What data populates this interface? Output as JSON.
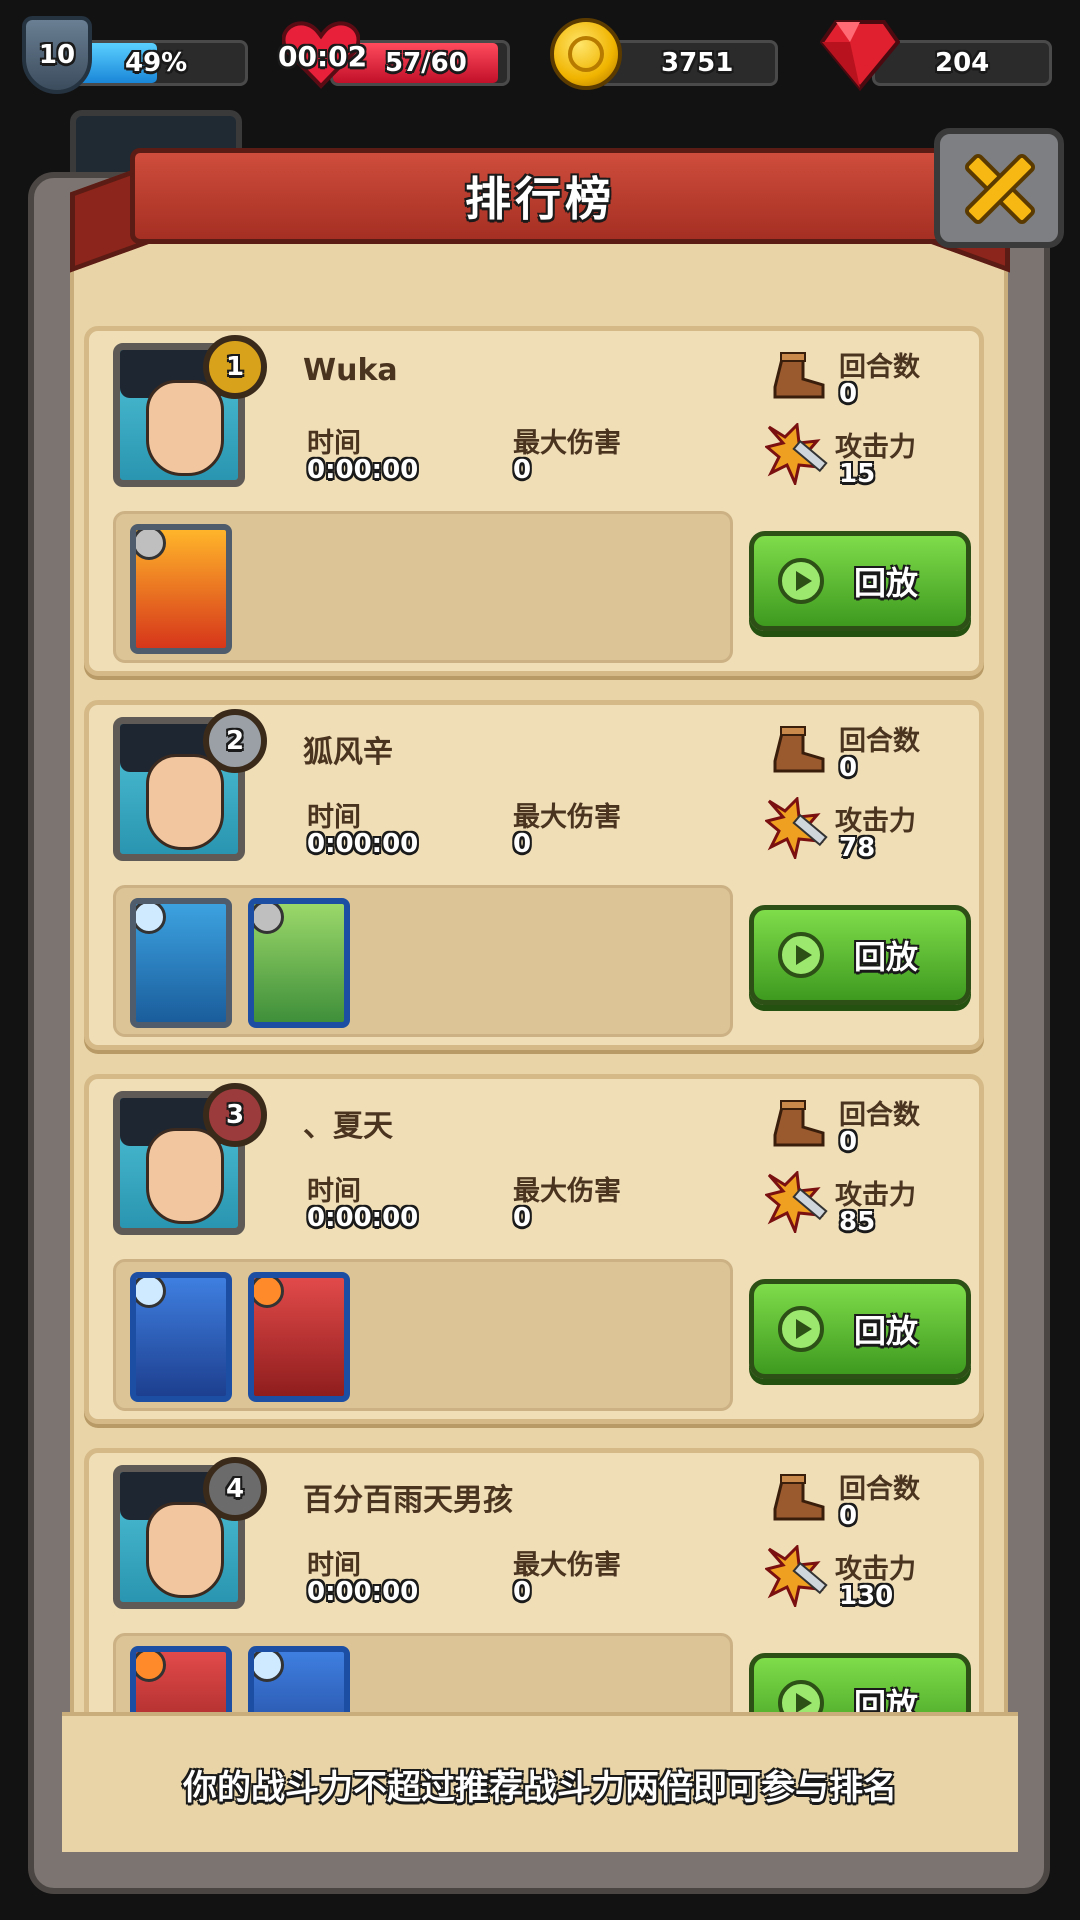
{
  "hud": {
    "level": "10",
    "xp_percent_label": "49%",
    "xp_fraction": 0.49,
    "timer": "00:02",
    "stamina": "57/60",
    "stamina_fraction": 0.95,
    "coins": "3751",
    "gems": "204"
  },
  "panel": {
    "title": "排行榜",
    "notice": "你的战斗力不超过推荐战斗力两倍即可参与排名"
  },
  "labels": {
    "time": "时间",
    "max_damage": "最大伤害",
    "rounds": "回合数",
    "attack": "攻击力",
    "replay": "回放"
  },
  "entries": [
    {
      "rank": "1",
      "name": "Wuka",
      "time": "0:00:00",
      "max_damage": "0",
      "rounds": "0",
      "attack": "15"
    },
    {
      "rank": "2",
      "name": "狐风辛",
      "time": "0:00:00",
      "max_damage": "0",
      "rounds": "0",
      "attack": "78"
    },
    {
      "rank": "3",
      "name": "、夏天",
      "time": "0:00:00",
      "max_damage": "0",
      "rounds": "0",
      "attack": "85"
    },
    {
      "rank": "4",
      "name": "百分百雨天男孩",
      "time": "0:00:00",
      "max_damage": "0",
      "rounds": "0",
      "attack": "130"
    }
  ],
  "colors": {
    "ribbon": "#c0402f",
    "replay_green": "#5cbf32",
    "gold_badge": "#d9a21b",
    "silver_badge": "#9aa0a6",
    "bronze_badge": "#9b3b3b",
    "plain_badge": "#6b6b6b"
  },
  "icons": [
    "shield-icon",
    "heart-icon",
    "coin-icon",
    "gem-icon",
    "close-icon",
    "boot-icon",
    "sword-icon",
    "play-icon"
  ]
}
